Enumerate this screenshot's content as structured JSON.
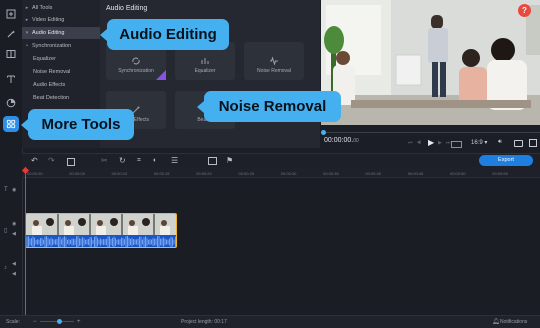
{
  "tree": {
    "items": [
      {
        "label": "All Tools",
        "twisty": "▸",
        "depth": 0
      },
      {
        "label": "Video Editing",
        "twisty": "▸",
        "depth": 0
      },
      {
        "label": "Audio Editing",
        "twisty": "▾",
        "depth": 0,
        "active": true
      },
      {
        "label": "Synchronization",
        "twisty": "•",
        "depth": 1
      },
      {
        "label": "Equalizer",
        "twisty": "",
        "depth": 1
      },
      {
        "label": "Noise Removal",
        "twisty": "",
        "depth": 1
      },
      {
        "label": "Audio Effects",
        "twisty": "",
        "depth": 1
      },
      {
        "label": "Beat Detection",
        "twisty": "",
        "depth": 1
      }
    ]
  },
  "tiles": {
    "title": "Audio Editing",
    "items": [
      {
        "label": "Synchronization",
        "icon": "sync-icon"
      },
      {
        "label": "Equalizer",
        "icon": "equalizer-icon"
      },
      {
        "label": "Noise Removal",
        "icon": "noise-removal-icon"
      },
      {
        "label": "Audio Effects",
        "icon": "audio-effects-icon"
      },
      {
        "label": "Beat Detection",
        "icon": "beat-detection-icon"
      }
    ],
    "visible_labels": [
      "Synchronization",
      "Equalizer",
      "Noise Removal",
      "udio Effects",
      "Beat D"
    ]
  },
  "callouts": {
    "audio_editing": "Audio Editing",
    "noise_removal": "Noise Removal",
    "more_tools": "More Tools"
  },
  "player": {
    "timecode": "00:00:00.",
    "timecode_small": "00",
    "aspect": "16:9",
    "progress": 0
  },
  "help_badge": "?",
  "toolbar": {
    "export_label": "Export"
  },
  "ruler": {
    "ticks": [
      "00:00:00",
      "00:00:05",
      "00:00:10",
      "00:00:15",
      "00:00:20",
      "00:00:25",
      "00:00:30",
      "00:00:35",
      "00:00:40",
      "00:00:45",
      "00:00:50",
      "00:00:55"
    ]
  },
  "status": {
    "scale_label": "Scale:",
    "project_length": "Project length:  00:17",
    "notifications": "Notifications"
  },
  "colors": {
    "accent": "#44b0f0",
    "export": "#1f7fe0",
    "clip_border": "#f0b429",
    "audio_wave": "#1a56c7",
    "playhead": "#e33a3a",
    "help": "#e84a3f"
  }
}
